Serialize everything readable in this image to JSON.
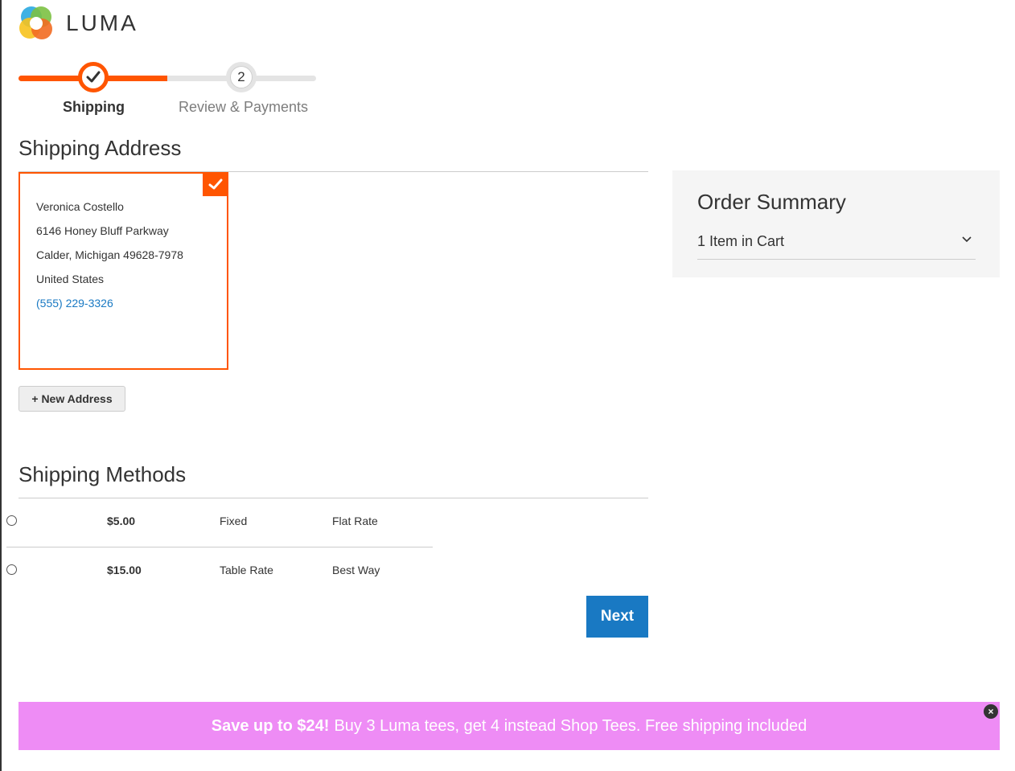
{
  "brand": {
    "name": "LUMA",
    "colors": {
      "accent": "#ff5501",
      "primary_button": "#1979c3",
      "promo": "#ee8cf5"
    }
  },
  "progress": {
    "steps": [
      {
        "label": "Shipping",
        "state": "complete"
      },
      {
        "number": "2",
        "label": "Review & Payments",
        "state": "pending"
      }
    ]
  },
  "shipping_address": {
    "title": "Shipping Address",
    "selected_card": {
      "name": "Veronica Costello",
      "street": "6146 Honey Bluff Parkway",
      "city_line": "Calder, Michigan 49628-7978",
      "country": "United States",
      "phone": "(555) 229-3326"
    },
    "new_address_label": "+ New Address"
  },
  "shipping_methods": {
    "title": "Shipping Methods",
    "rows": [
      {
        "price": "$5.00",
        "method": "Fixed",
        "carrier": "Flat Rate",
        "selected": false
      },
      {
        "price": "$15.00",
        "method": "Table Rate",
        "carrier": "Best Way",
        "selected": false
      }
    ],
    "next_label": "Next"
  },
  "order_summary": {
    "title": "Order Summary",
    "items_label": "1 Item in Cart"
  },
  "promo": {
    "highlight": "Save up to $24!",
    "text": "Buy 3 Luma tees, get 4 instead Shop Tees. Free shipping included",
    "close_icon": "close-icon"
  }
}
